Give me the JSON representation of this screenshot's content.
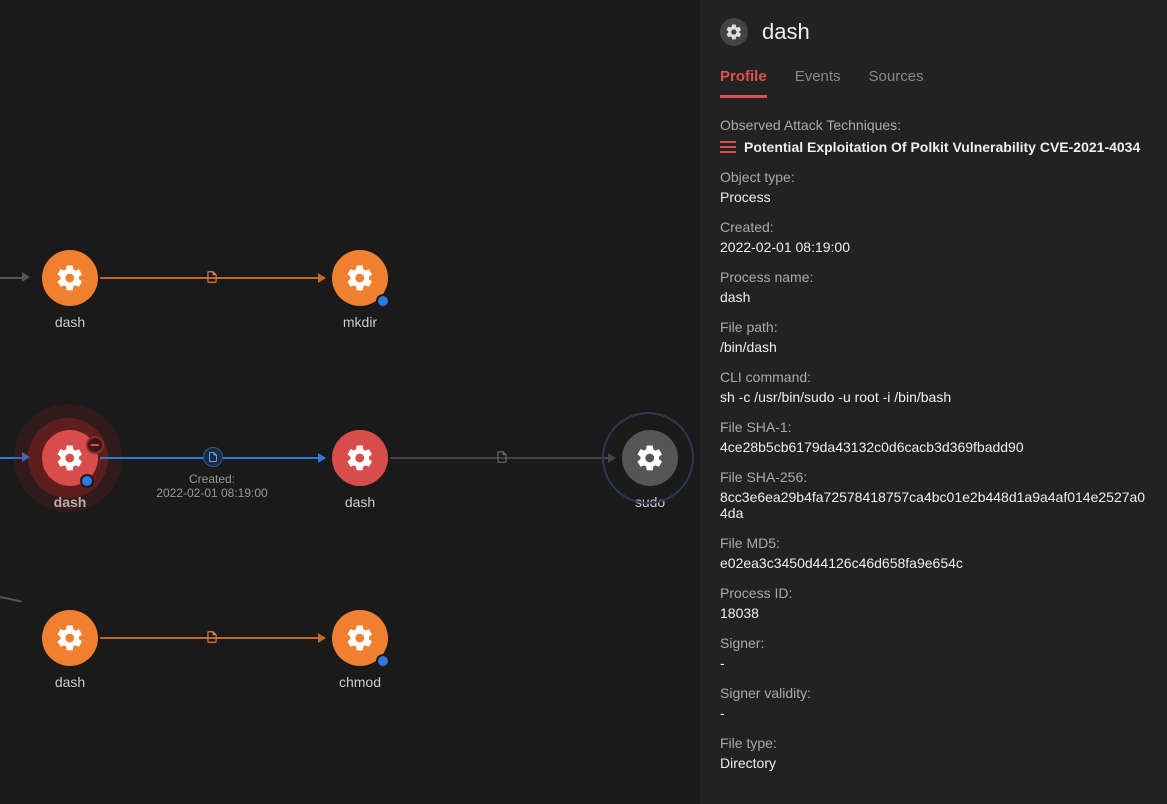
{
  "panel": {
    "title": "dash",
    "tabs": {
      "profile": "Profile",
      "events": "Events",
      "sources": "Sources"
    },
    "observed_label": "Observed Attack Techniques:",
    "observed_value": "Potential Exploitation Of Polkit Vulnerability CVE-2021-4034",
    "objtype_label": "Object type:",
    "objtype_value": "Process",
    "created_label": "Created:",
    "created_value": "2022-02-01 08:19:00",
    "procname_label": "Process name:",
    "procname_value": "dash",
    "filepath_label": "File path:",
    "filepath_value": "/bin/dash",
    "cli_label": "CLI command:",
    "cli_value": "sh -c /usr/bin/sudo -u root -i /bin/bash",
    "sha1_label": "File SHA-1:",
    "sha1_value": "4ce28b5cb6179da43132c0d6cacb3d369fbadd90",
    "sha256_label": "File SHA-256:",
    "sha256_value": "8cc3e6ea29b4fa72578418757ca4bc01e2b448d1a9a4af014e2527a04da",
    "md5_label": "File MD5:",
    "md5_value": "e02ea3c3450d44126c46d658fa9e654c",
    "pid_label": "Process ID:",
    "pid_value": "18038",
    "signer_label": "Signer:",
    "signer_value": "-",
    "signval_label": "Signer validity:",
    "signval_value": "-",
    "ftype_label": "File type:",
    "ftype_value": "Directory"
  },
  "graph": {
    "node_dash1": "dash",
    "node_mkdir": "mkdir",
    "node_dash_sel": "dash",
    "node_dash2": "dash",
    "node_sudo": "sudo",
    "node_dash3": "dash",
    "node_chmod": "chmod",
    "edge_caption_label": "Created:",
    "edge_caption_value": "2022-02-01 08:19:00"
  }
}
